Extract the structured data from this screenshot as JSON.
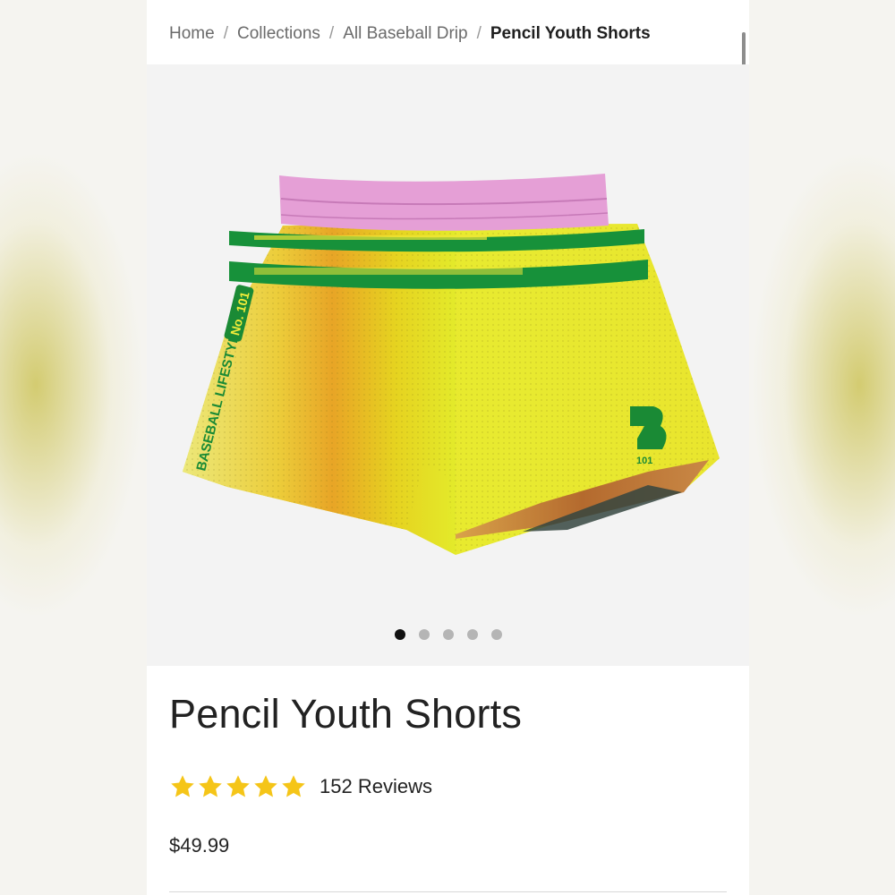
{
  "breadcrumb": {
    "items": [
      "Home",
      "Collections",
      "All Baseball Drip"
    ],
    "current": "Pencil Youth Shorts",
    "separator": "/"
  },
  "product": {
    "title": "Pencil Youth Shorts",
    "rating": 5,
    "rating_max": 5,
    "reviews_label": "152 Reviews",
    "price": "$49.99",
    "image": {
      "print_text": "BASEBALL LIFESTYLE",
      "badge_text": "No. 101",
      "logo_text": "101"
    }
  },
  "gallery": {
    "slide_count": 5,
    "active_index": 0
  },
  "colors": {
    "star": "#f5c518",
    "waistband": "#e49ad6",
    "shorts_yellow": "#ecea2a",
    "trim_green": "#17913a"
  },
  "icons": [
    "star-icon",
    "carousel-dot"
  ]
}
